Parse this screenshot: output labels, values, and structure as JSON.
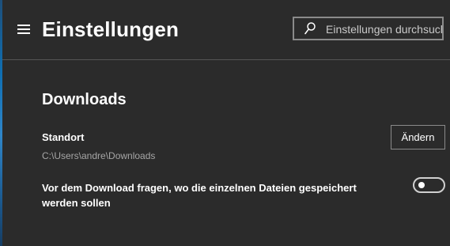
{
  "header": {
    "title": "Einstellungen",
    "search": {
      "placeholder": "Einstellungen durchsuchen",
      "value": ""
    }
  },
  "downloads": {
    "section_title": "Downloads",
    "location": {
      "label": "Standort",
      "path": "C:\\Users\\andre\\Downloads",
      "change_button": "Ändern"
    },
    "ask_before_download": {
      "label": "Vor dem Download fragen, wo die einzelnen Dateien gespeichert werden sollen",
      "enabled": false
    }
  },
  "icons": {
    "menu": "hamburger-menu-icon",
    "search": "search-icon"
  },
  "colors": {
    "background": "#2b2b2b",
    "text": "#ffffff",
    "secondary_text": "#a6a6a6",
    "border": "#8a8a8a"
  }
}
